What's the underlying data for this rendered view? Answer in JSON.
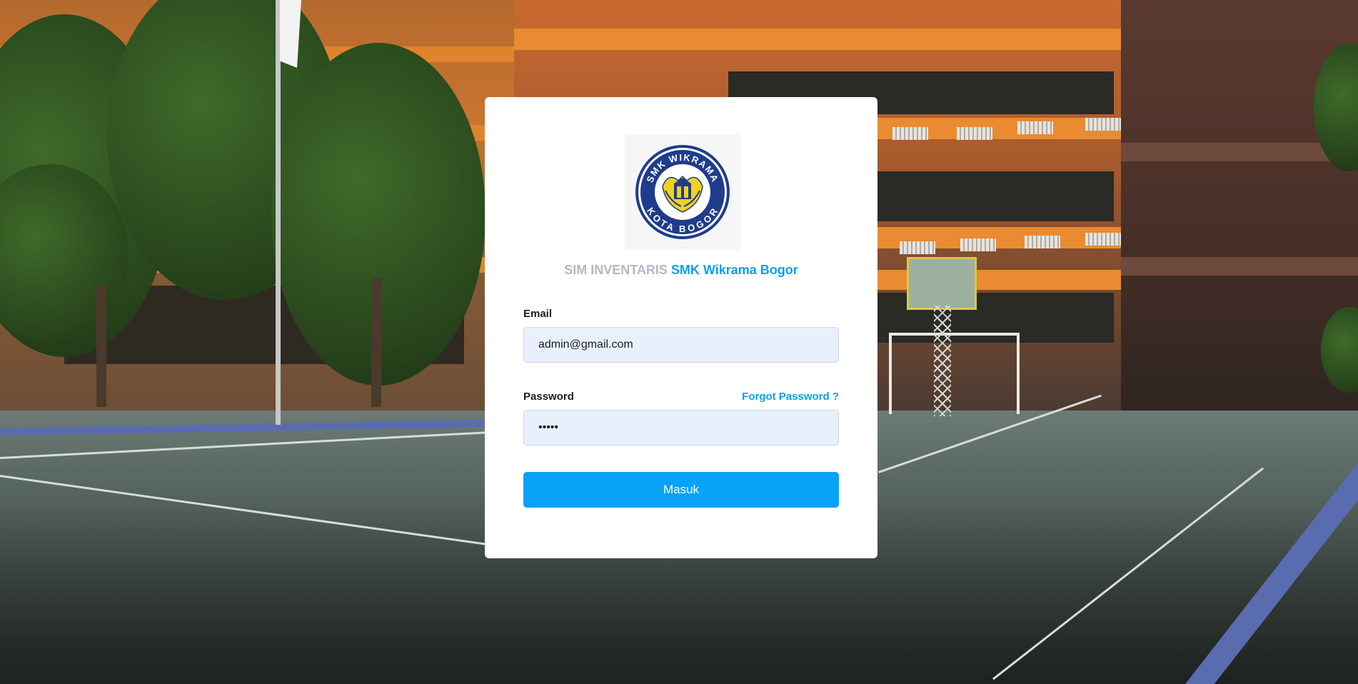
{
  "app": {
    "title_prefix": "SIM INVENTARIS",
    "title_school": "SMK Wikrama Bogor"
  },
  "logo": {
    "top_text": "SMK WIKRAMA",
    "bottom_text": "KOTA BOGOR",
    "colors": {
      "ring": "#1f3c8c",
      "emblem": "#f2d21c",
      "inner": "#ffffff"
    }
  },
  "form": {
    "email_label": "Email",
    "email_value": "admin@gmail.com",
    "password_label": "Password",
    "password_value": "•••••",
    "forgot_label": "Forgot Password ?",
    "submit_label": "Masuk"
  },
  "colors": {
    "accent": "#08a2f8",
    "input_bg": "#e8f0fe",
    "title_muted": "#b2b8c4"
  }
}
